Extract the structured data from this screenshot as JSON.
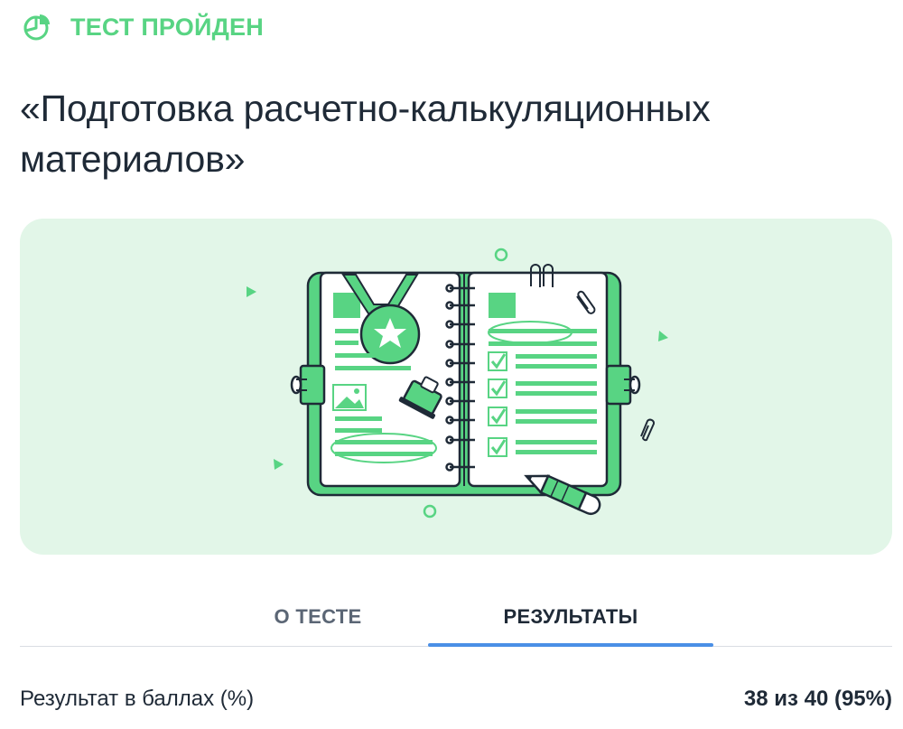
{
  "status": {
    "label": "ТЕСТ ПРОЙДЕН",
    "icon": "pie-chart-icon",
    "color": "#58d483"
  },
  "test": {
    "title_line1": "«Подготовка расчетно-калькуляционных",
    "title_line2": "материалов»"
  },
  "hero": {
    "illustration": "notebook-illustration",
    "background": "#e2f6e8",
    "accent": "#58d483"
  },
  "tabs": [
    {
      "label": "О ТЕСТЕ",
      "active": false
    },
    {
      "label": "РЕЗУЛЬТАТЫ",
      "active": true
    }
  ],
  "results": {
    "label": "Результат в баллах (%)",
    "value": "38 из 40 (95%)"
  }
}
